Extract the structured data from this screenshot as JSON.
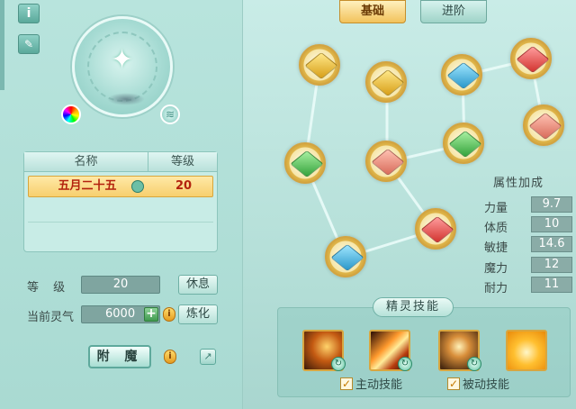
{
  "tabs": {
    "basic": "基础",
    "advanced": "进阶"
  },
  "side_buttons": {
    "info": "i"
  },
  "pet_list": {
    "header_name": "名称",
    "header_level": "等级",
    "rows": [
      {
        "name": "五月二十五",
        "level": "20"
      }
    ]
  },
  "stats": {
    "level_label": "等 级",
    "level_value": "20",
    "rest_button": "休息",
    "spirit_label": "当前灵气",
    "spirit_value": "6000",
    "refine_button": "炼化"
  },
  "enchant_button": "附 魔",
  "attributes": {
    "title": "属性加成",
    "rows": [
      {
        "label": "力量",
        "value": "9.7"
      },
      {
        "label": "体质",
        "value": "10"
      },
      {
        "label": "敏捷",
        "value": "14.6"
      },
      {
        "label": "魔力",
        "value": "12"
      },
      {
        "label": "耐力",
        "value": "11"
      }
    ]
  },
  "skills": {
    "title": "精灵技能",
    "active_label": "主动技能",
    "passive_label": "被动技能",
    "active_checked": true,
    "passive_checked": true
  },
  "colors": {
    "accent_gold": "#f2c25b",
    "panel_teal": "#b6e0d9",
    "level_text_red": "#b3220e"
  },
  "icons": {
    "info": "info-icon",
    "edit": "edit-icon",
    "rainbow_orb": "rainbow-orb-icon",
    "wind_orb": "wind-orb-icon",
    "gem": "gem-icon",
    "plus": "plus-icon",
    "coin": "coin-icon",
    "share": "share-icon"
  }
}
